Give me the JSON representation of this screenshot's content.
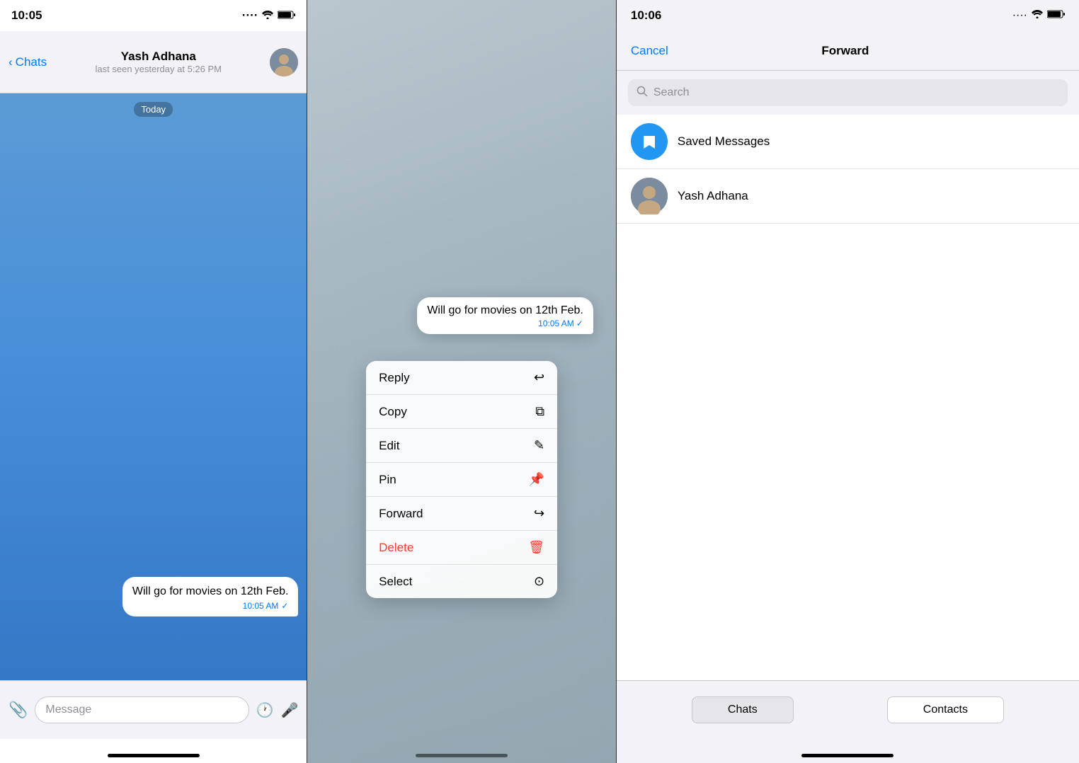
{
  "panel1": {
    "status_time": "10:05",
    "back_label": "Chats",
    "contact_name": "Yash Adhana",
    "contact_status": "last seen yesterday at 5:26 PM",
    "date_badge": "Today",
    "message_text": "Will go for movies on 12th Feb.",
    "message_time": "10:05 AM",
    "input_placeholder": "Message"
  },
  "panel2": {
    "message_text": "Will go for movies on 12th Feb.",
    "message_time": "10:05 AM",
    "menu_items": [
      {
        "label": "Reply",
        "icon": "↩"
      },
      {
        "label": "Copy",
        "icon": "⧉"
      },
      {
        "label": "Edit",
        "icon": "✎"
      },
      {
        "label": "Pin",
        "icon": "⊕"
      },
      {
        "label": "Forward",
        "icon": "↪"
      },
      {
        "label": "Delete",
        "icon": "🗑",
        "is_delete": true
      },
      {
        "label": "Select",
        "icon": "✓"
      }
    ]
  },
  "panel3": {
    "status_time": "10:06",
    "cancel_label": "Cancel",
    "title": "Forward",
    "search_placeholder": "Search",
    "contacts": [
      {
        "name": "Saved Messages",
        "type": "saved"
      },
      {
        "name": "Yash Adhana",
        "type": "yash"
      }
    ],
    "tabs": [
      {
        "label": "Chats",
        "active": true
      },
      {
        "label": "Contacts",
        "active": false
      }
    ]
  }
}
